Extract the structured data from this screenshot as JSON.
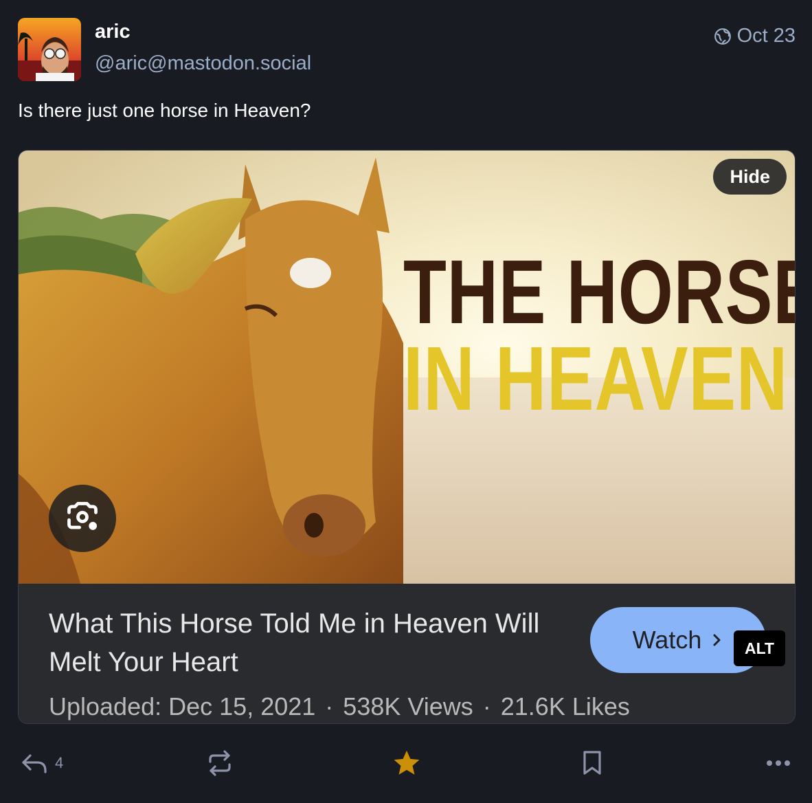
{
  "post": {
    "display_name": "aric",
    "handle": "@aric@mastodon.social",
    "timestamp": "Oct 23",
    "text": "Is there just one horse in Heaven?"
  },
  "media": {
    "hide_label": "Hide",
    "alt_label": "ALT",
    "headline_line1": "THE HORSE",
    "headline_line2": "IN HEAVEN",
    "video_title": "What This Horse Told Me in Heaven Will Melt Your Heart",
    "uploaded": "Uploaded: Dec 15, 2021",
    "views": "538K Views",
    "likes": "21.6K Likes",
    "separator": "·",
    "watch_label": "Watch"
  },
  "actions": {
    "reply_count": "4"
  },
  "colors": {
    "background": "#191b22",
    "muted": "#9baec8",
    "favourite_active": "#ca8f04",
    "watch_button": "#8ab4f8"
  },
  "icons": {
    "visibility": "globe-icon",
    "reply": "reply-icon",
    "boost": "boost-icon",
    "favourite": "star-icon",
    "bookmark": "bookmark-icon",
    "more": "more-icon",
    "lens": "camera-lens-icon",
    "watch": "chevron-right-icon"
  }
}
